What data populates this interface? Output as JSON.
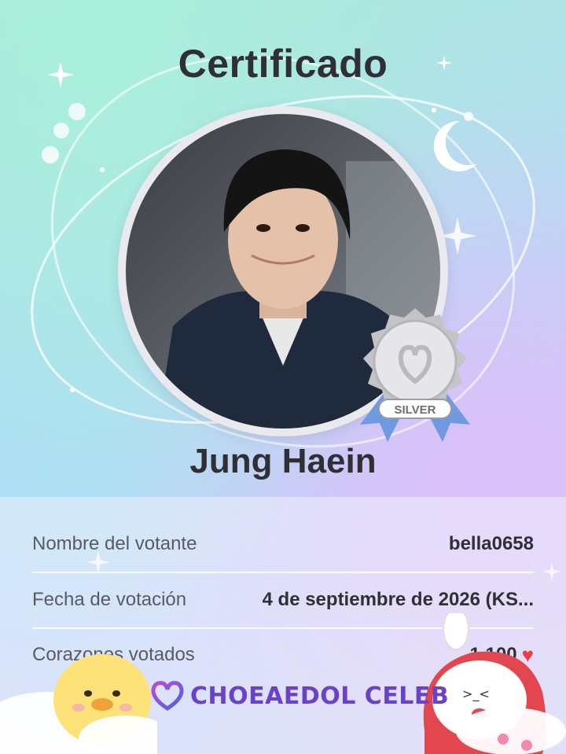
{
  "certificate": {
    "title": "Certificado",
    "idol_name": "Jung Haein",
    "badge_label": "SILVER",
    "rows": [
      {
        "label": "Nombre del votante",
        "value": "bella0658"
      },
      {
        "label": "Fecha de votación",
        "value": "4 de septiembre de 2026 (KS..."
      },
      {
        "label": "Corazones votados",
        "value": "1.100"
      }
    ]
  },
  "brand": {
    "name": "CHOEAEDOL CELEB"
  },
  "icons": {
    "heart": "heart-icon",
    "badge": "silver-medal-icon",
    "logo": "choeaedol-logo-icon",
    "moon": "crescent-moon-icon",
    "sparkle": "sparkle-icon"
  },
  "colors": {
    "accent": "#6a41c9",
    "heart": "#ee3b4f",
    "text": "#2f2f36"
  }
}
